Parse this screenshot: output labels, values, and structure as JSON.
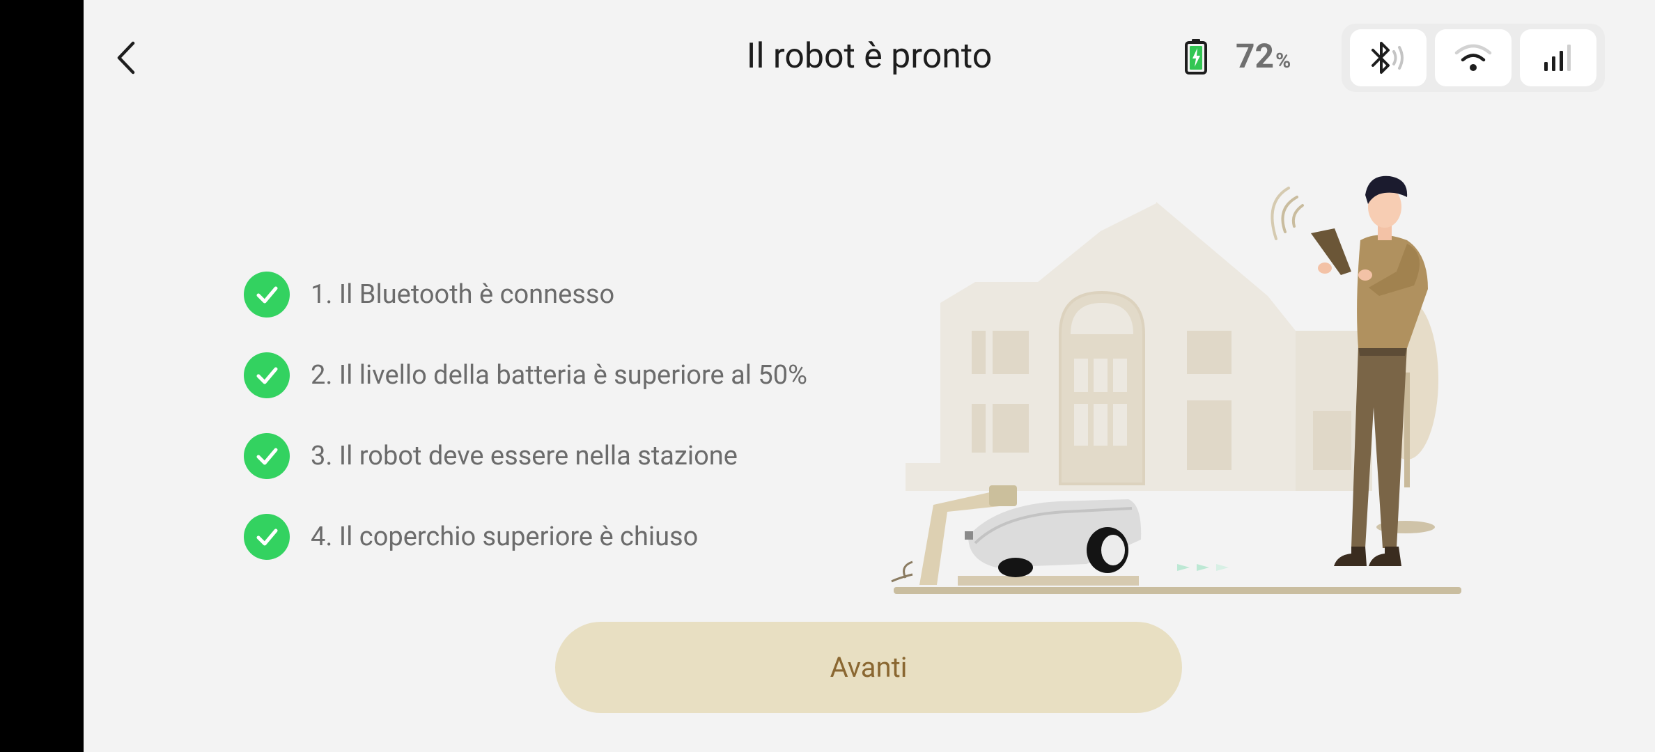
{
  "header": {
    "title": "Il robot è pronto",
    "battery_value": "72",
    "battery_unit": "%"
  },
  "status_icons": [
    "bluetooth-icon",
    "wifi-icon",
    "cellular-signal-icon"
  ],
  "checklist": [
    "1. Il Bluetooth è connesso",
    "2. Il livello della batteria è superiore al 50%",
    "3. Il robot deve essere nella stazione",
    "4. Il coperchio superiore è chiuso"
  ],
  "footer": {
    "next_label": "Avanti"
  },
  "colors": {
    "check_green": "#33d260",
    "button_bg": "#e8dfc2",
    "button_text": "#8a6731",
    "battery_green": "#33c653"
  }
}
